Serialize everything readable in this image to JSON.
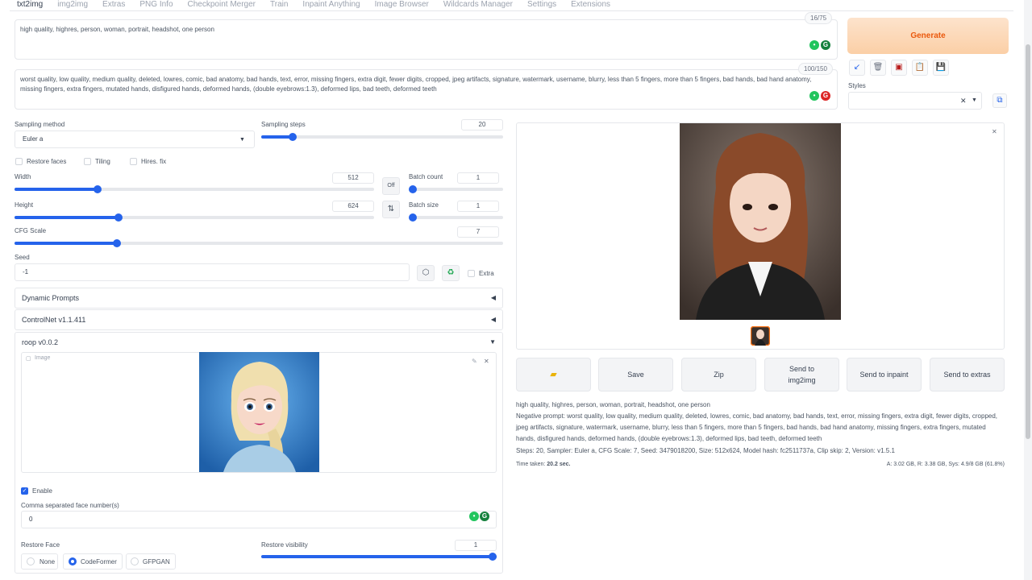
{
  "tabs": [
    "txt2img",
    "img2img",
    "Extras",
    "PNG Info",
    "Checkpoint Merger",
    "Train",
    "Inpaint Anything",
    "Image Browser",
    "Wildcards Manager",
    "Settings",
    "Extensions"
  ],
  "prompt": {
    "positive": "high quality, highres, person, woman, portrait, headshot, one person",
    "positive_counter": "16/75",
    "negative": "worst quality, low quality, medium quality, deleted, lowres, comic, bad anatomy, bad hands, text, error, missing fingers, extra digit, fewer digits, cropped, jpeg artifacts, signature, watermark, username, blurry, less than 5 fingers, more than 5 fingers, bad hands, bad hand anatomy, missing fingers, extra fingers, mutated hands, disfigured hands, deformed hands, (double eyebrows:1.3), deformed lips, bad teeth, deformed teeth",
    "negative_counter": "100/150"
  },
  "generate_label": "Generate",
  "styles_label": "Styles",
  "sampling": {
    "method_label": "Sampling method",
    "method_value": "Euler a",
    "steps_label": "Sampling steps",
    "steps_value": "20",
    "steps_fraction": 0.13
  },
  "checkboxes": {
    "restore_faces": "Restore faces",
    "tiling": "Tiling",
    "hires_fix": "Hires. fix"
  },
  "width": {
    "label": "Width",
    "value": "512",
    "fraction": 0.23
  },
  "height": {
    "label": "Height",
    "value": "624",
    "fraction": 0.29
  },
  "off_label": "Off",
  "swap_icon": "⇅",
  "batch_count": {
    "label": "Batch count",
    "value": "1",
    "fraction": 0.0
  },
  "batch_size": {
    "label": "Batch size",
    "value": "1",
    "fraction": 0.0
  },
  "cfg": {
    "label": "CFG Scale",
    "value": "7",
    "fraction": 0.21
  },
  "seed": {
    "label": "Seed",
    "value": "-1",
    "extra_label": "Extra"
  },
  "accordions": {
    "dynamic_prompts": "Dynamic Prompts",
    "controlnet": "ControlNet v1.1.411",
    "roop": "roop v0.0.2"
  },
  "roop": {
    "image_label": "Image",
    "enable_label": "Enable",
    "face_numbers_label": "Comma separated face number(s)",
    "face_numbers_value": "0",
    "restore_face_label": "Restore Face",
    "restore_options": [
      "None",
      "CodeFormer",
      "GFPGAN"
    ],
    "restore_selected": "CodeFormer",
    "restore_visibility_label": "Restore visibility",
    "restore_visibility_value": "1",
    "restore_visibility_fraction": 1.0
  },
  "actions": {
    "folder_icon": "folder-icon",
    "save": "Save",
    "zip": "Zip",
    "send_img2img": "Send to img2img",
    "send_inpaint": "Send to inpaint",
    "send_extras": "Send to extras"
  },
  "info": {
    "line1": "high quality, highres, person, woman, portrait, headshot, one person",
    "negative": "Negative prompt: worst quality, low quality, medium quality, deleted, lowres, comic, bad anatomy, bad hands, text, error, missing fingers, extra digit, fewer digits, cropped, jpeg artifacts, signature, watermark, username, blurry, less than 5 fingers, more than 5 fingers, bad hands, bad hand anatomy, missing fingers, extra fingers, mutated hands, disfigured hands, deformed hands, (double eyebrows:1.3), deformed lips, bad teeth, deformed teeth",
    "params": "Steps: 20, Sampler: Euler a, CFG Scale: 7, Seed: 3479018200, Size: 512x624, Model hash: fc2511737a, Clip skip: 2, Version: v1.5.1",
    "time_label": "Time taken: ",
    "time_value": "20.2 sec.",
    "memory": "A: 3.02 GB, R: 3.38 GB, Sys: 4.9/8 GB (61.8%)"
  },
  "colors": {
    "accent": "#2563eb",
    "generate": "#ea580c"
  }
}
